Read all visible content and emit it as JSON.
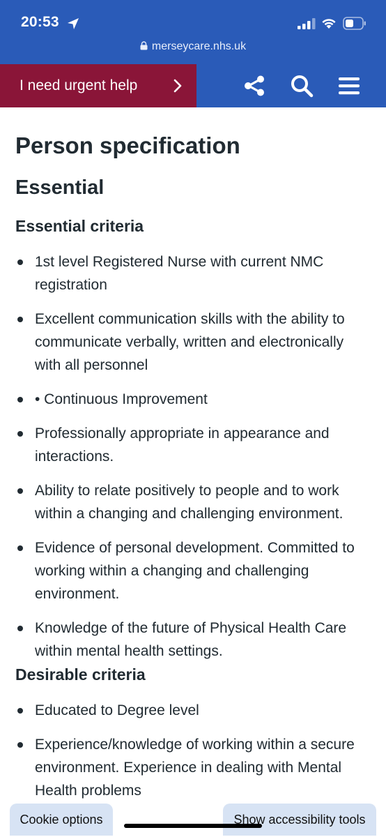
{
  "status_bar": {
    "time": "20:53",
    "url": "merseycare.nhs.uk",
    "icons": [
      "location-arrow-icon",
      "signal-icon",
      "wifi-icon",
      "battery-icon",
      "lock-icon"
    ]
  },
  "header": {
    "urgent_label": "I need urgent help",
    "icons": [
      "chevron-right-icon",
      "share-icon",
      "search-icon",
      "menu-icon"
    ],
    "colors": {
      "header_bg": "#2a5bb8",
      "urgent_bg": "#8a1538"
    }
  },
  "main": {
    "title": "Person specification",
    "section": "Essential",
    "essential_heading": "Essential criteria",
    "essential_items": [
      "1st level Registered Nurse with current NMC registration",
      "Excellent communication skills with the ability to communicate verbally, written and electronically with all personnel",
      "• Continuous Improvement",
      "Professionally appropriate in appearance and interactions.",
      "Ability to relate positively to people and to work within a changing and challenging environment.",
      "Evidence of personal development. Committed to working within a changing and challenging environment.",
      "Knowledge of the future of Physical Health Care within mental health settings."
    ],
    "desirable_heading": "Desirable criteria",
    "desirable_items": [
      "Educated to Degree level",
      "Experience/knowledge of working within a secure environment. Experience in dealing with Mental Health problems"
    ]
  },
  "footer": {
    "cookie_label": "Cookie options",
    "accessibility_label": "Show accessibility tools"
  }
}
